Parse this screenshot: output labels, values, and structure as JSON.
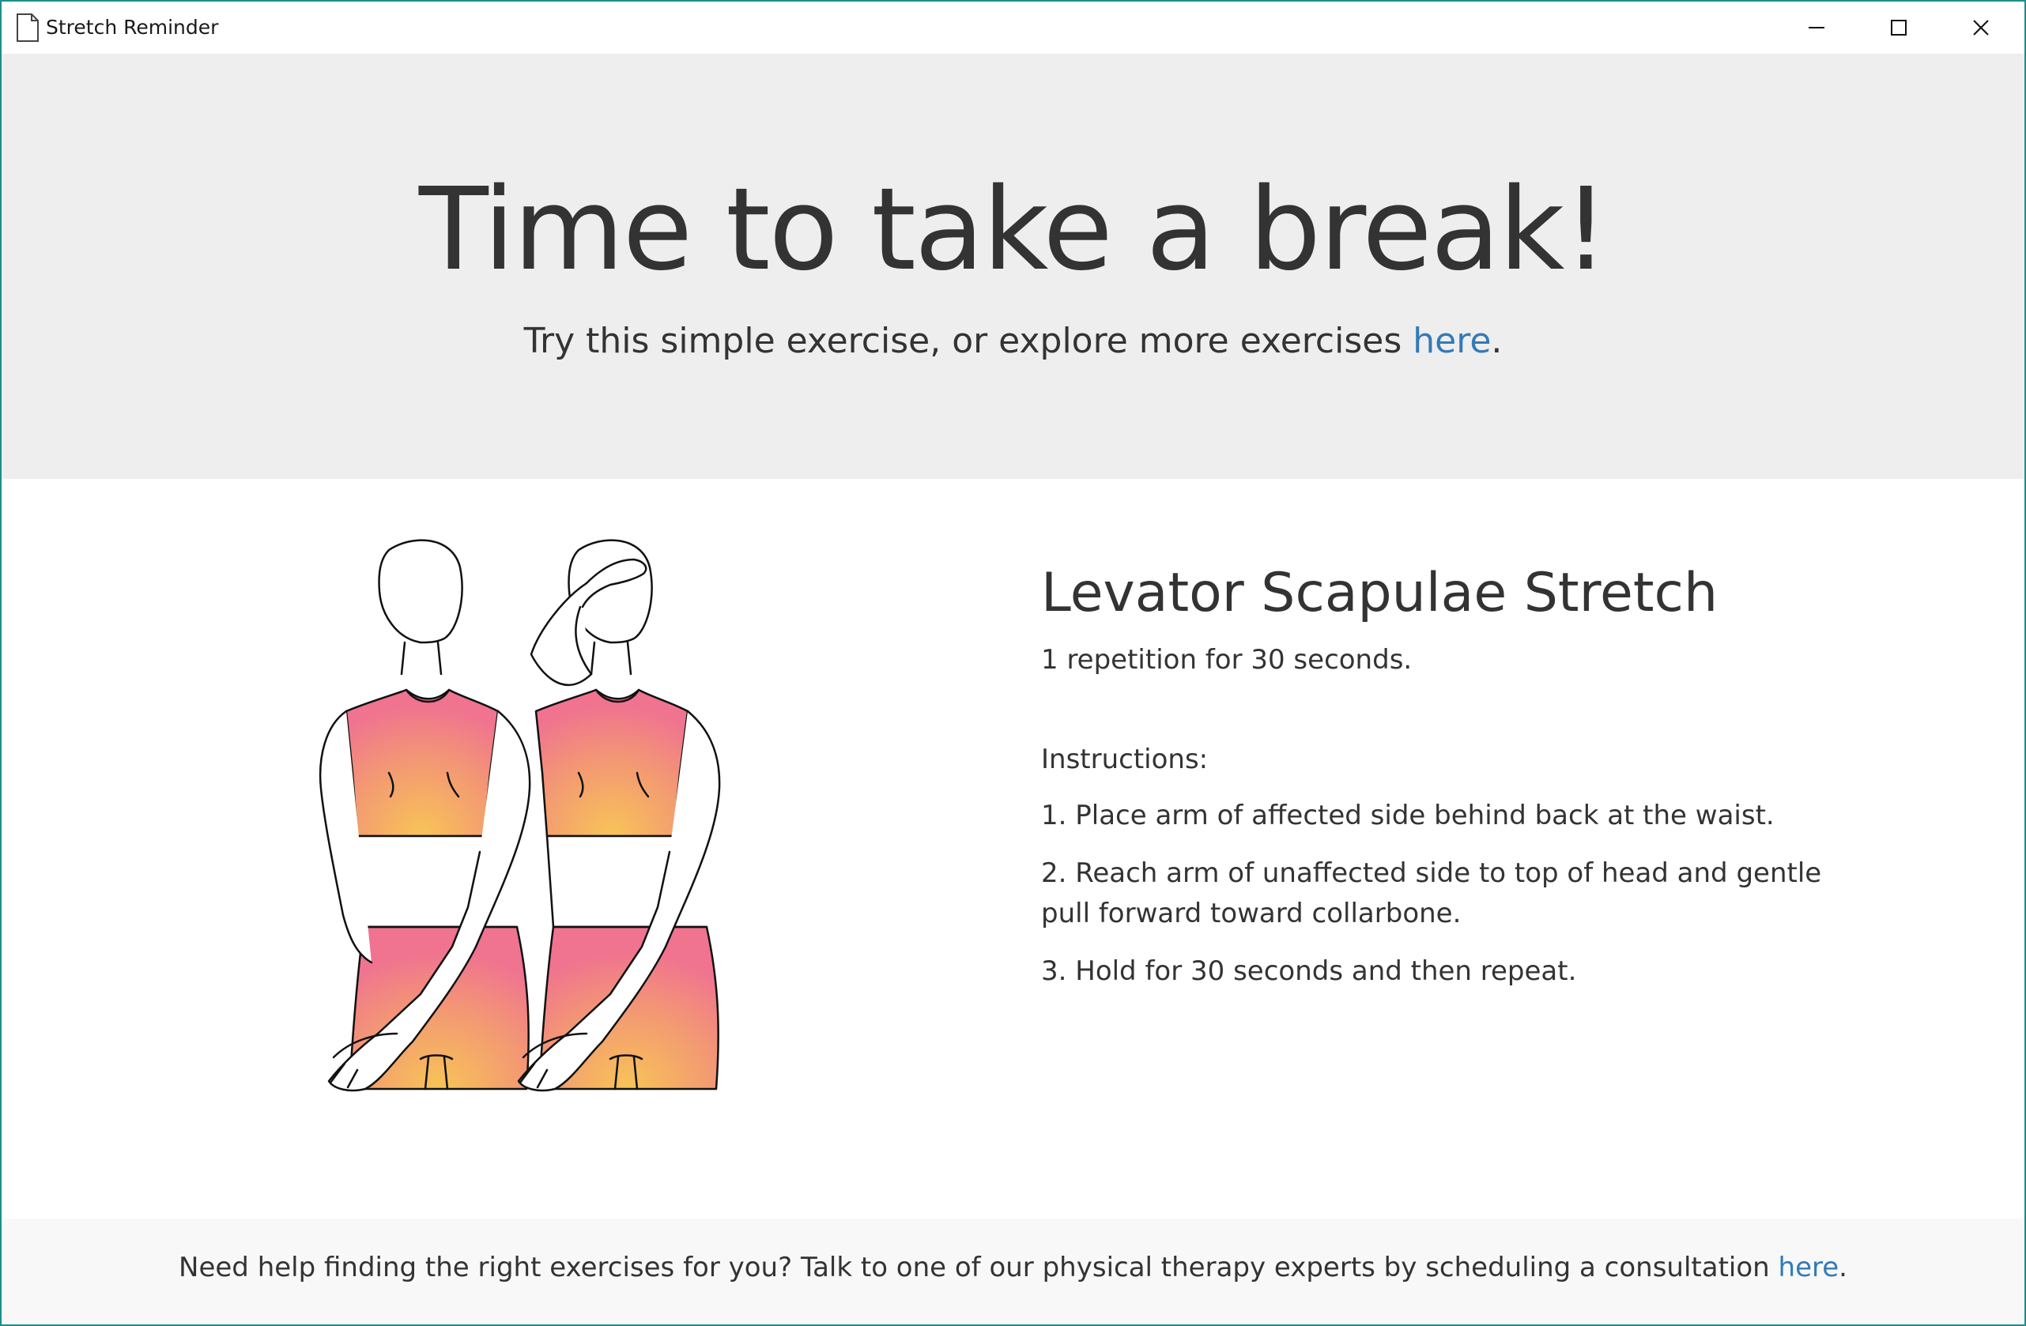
{
  "window": {
    "title": "Stretch Reminder",
    "icons": {
      "app": "document-icon",
      "minimize": "minimize-icon",
      "maximize": "maximize-icon",
      "close": "close-icon"
    }
  },
  "hero": {
    "heading": "Time to take a break!",
    "subtitle_before": "Try this simple exercise, or explore more exercises ",
    "subtitle_link": "here",
    "subtitle_after": "."
  },
  "exercise": {
    "name": "Levator Scapulae Stretch",
    "repetitions": "1 repetition for 30 seconds.",
    "instructions_label": "Instructions:",
    "steps": [
      "1. Place arm of affected side behind back at the waist.",
      "2. Reach arm of unaffected side to top of head and gentle pull forward toward collarbone.",
      "3. Hold for 30 seconds and then repeat."
    ]
  },
  "footer": {
    "text_before": "Need help finding the right exercises for you? Talk to one of our physical therapy experts by scheduling a consultation ",
    "link": "here",
    "text_after": "."
  },
  "colors": {
    "link": "#337ab7",
    "hero_bg": "#eeeeee",
    "footer_bg": "#f8f8f8",
    "garment_pink": "#f07390",
    "garment_yellow": "#f8bd55"
  }
}
